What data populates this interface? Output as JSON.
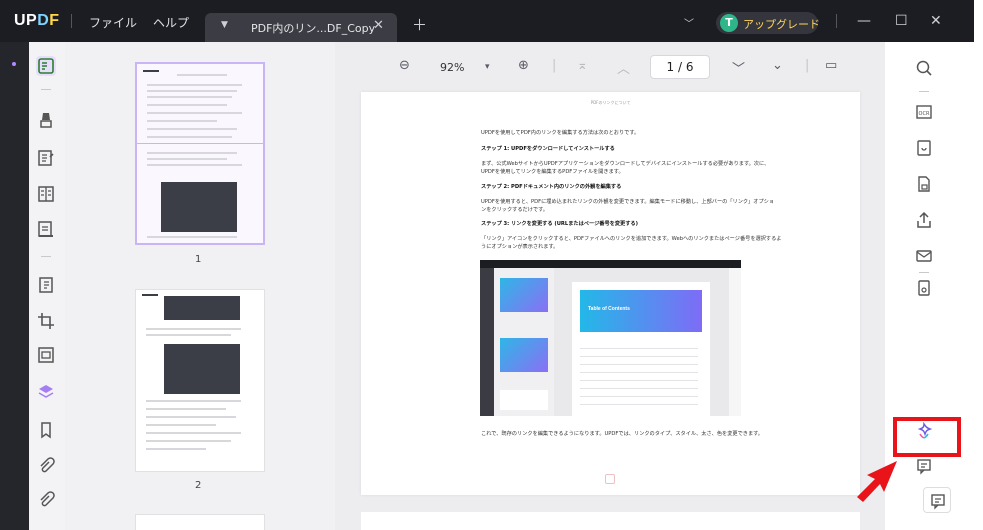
{
  "titlebar": {
    "logo": "UPDF",
    "menu": [
      "ファイル",
      "ヘルプ"
    ],
    "tab_name": "PDF内のリン...DF_Copy",
    "avatar_letter": "T",
    "upgrade_label": "アップグレード"
  },
  "zoombar": {
    "zoom": "92%",
    "page_indicator": "1 / 6"
  },
  "thumbnails": {
    "pages": [
      "1",
      "2"
    ]
  },
  "document": {
    "header": "PDFのリンクについて",
    "intro": "UPDFを使用してPDF内のリンクを編集する方法は次のとおりです。",
    "step1_title": "ステップ 1: UPDFをダウンロードしてインストールする",
    "step1_body_1": "まず、公式WebサイトからUPDFアプリケーションをダウンロードしてデバイスにインストールする必要があります。次に、",
    "step1_body_2": "UPDFを使用してリンクを編集するPDFファイルを開きます。",
    "step2_title": "ステップ 2: PDFドキュメント内のリンクの外観を編集する",
    "step2_body_1": "UPDFを使用すると、PDFに埋め込まれたリンクの外観を変更できます。編集モードに移動し、上部バーの「リンク」オプショ",
    "step2_body_2": "ンをクリックするだけです。",
    "step3_title": "ステップ 3: リンクを変更する (URLまたはページ番号を変更する)",
    "step3_body_1": "「リンク」アイコンをクリックすると、PDFファイルへのリンクを追加できます。Webへのリンクまたはページ番号を選択するよ",
    "step3_body_2": "うにオプションが表示されます。",
    "embedded_title": "Table of Contents",
    "conclusion": "これで、既存のリンクを編集できるようになります。UPDFでは、リンクのタイプ、スタイル、太さ、色を変更できます。"
  },
  "colors": {
    "accent": "#8b5cf6",
    "highlight_box": "#e8141a",
    "titlebar_bg": "#1c1d22"
  }
}
